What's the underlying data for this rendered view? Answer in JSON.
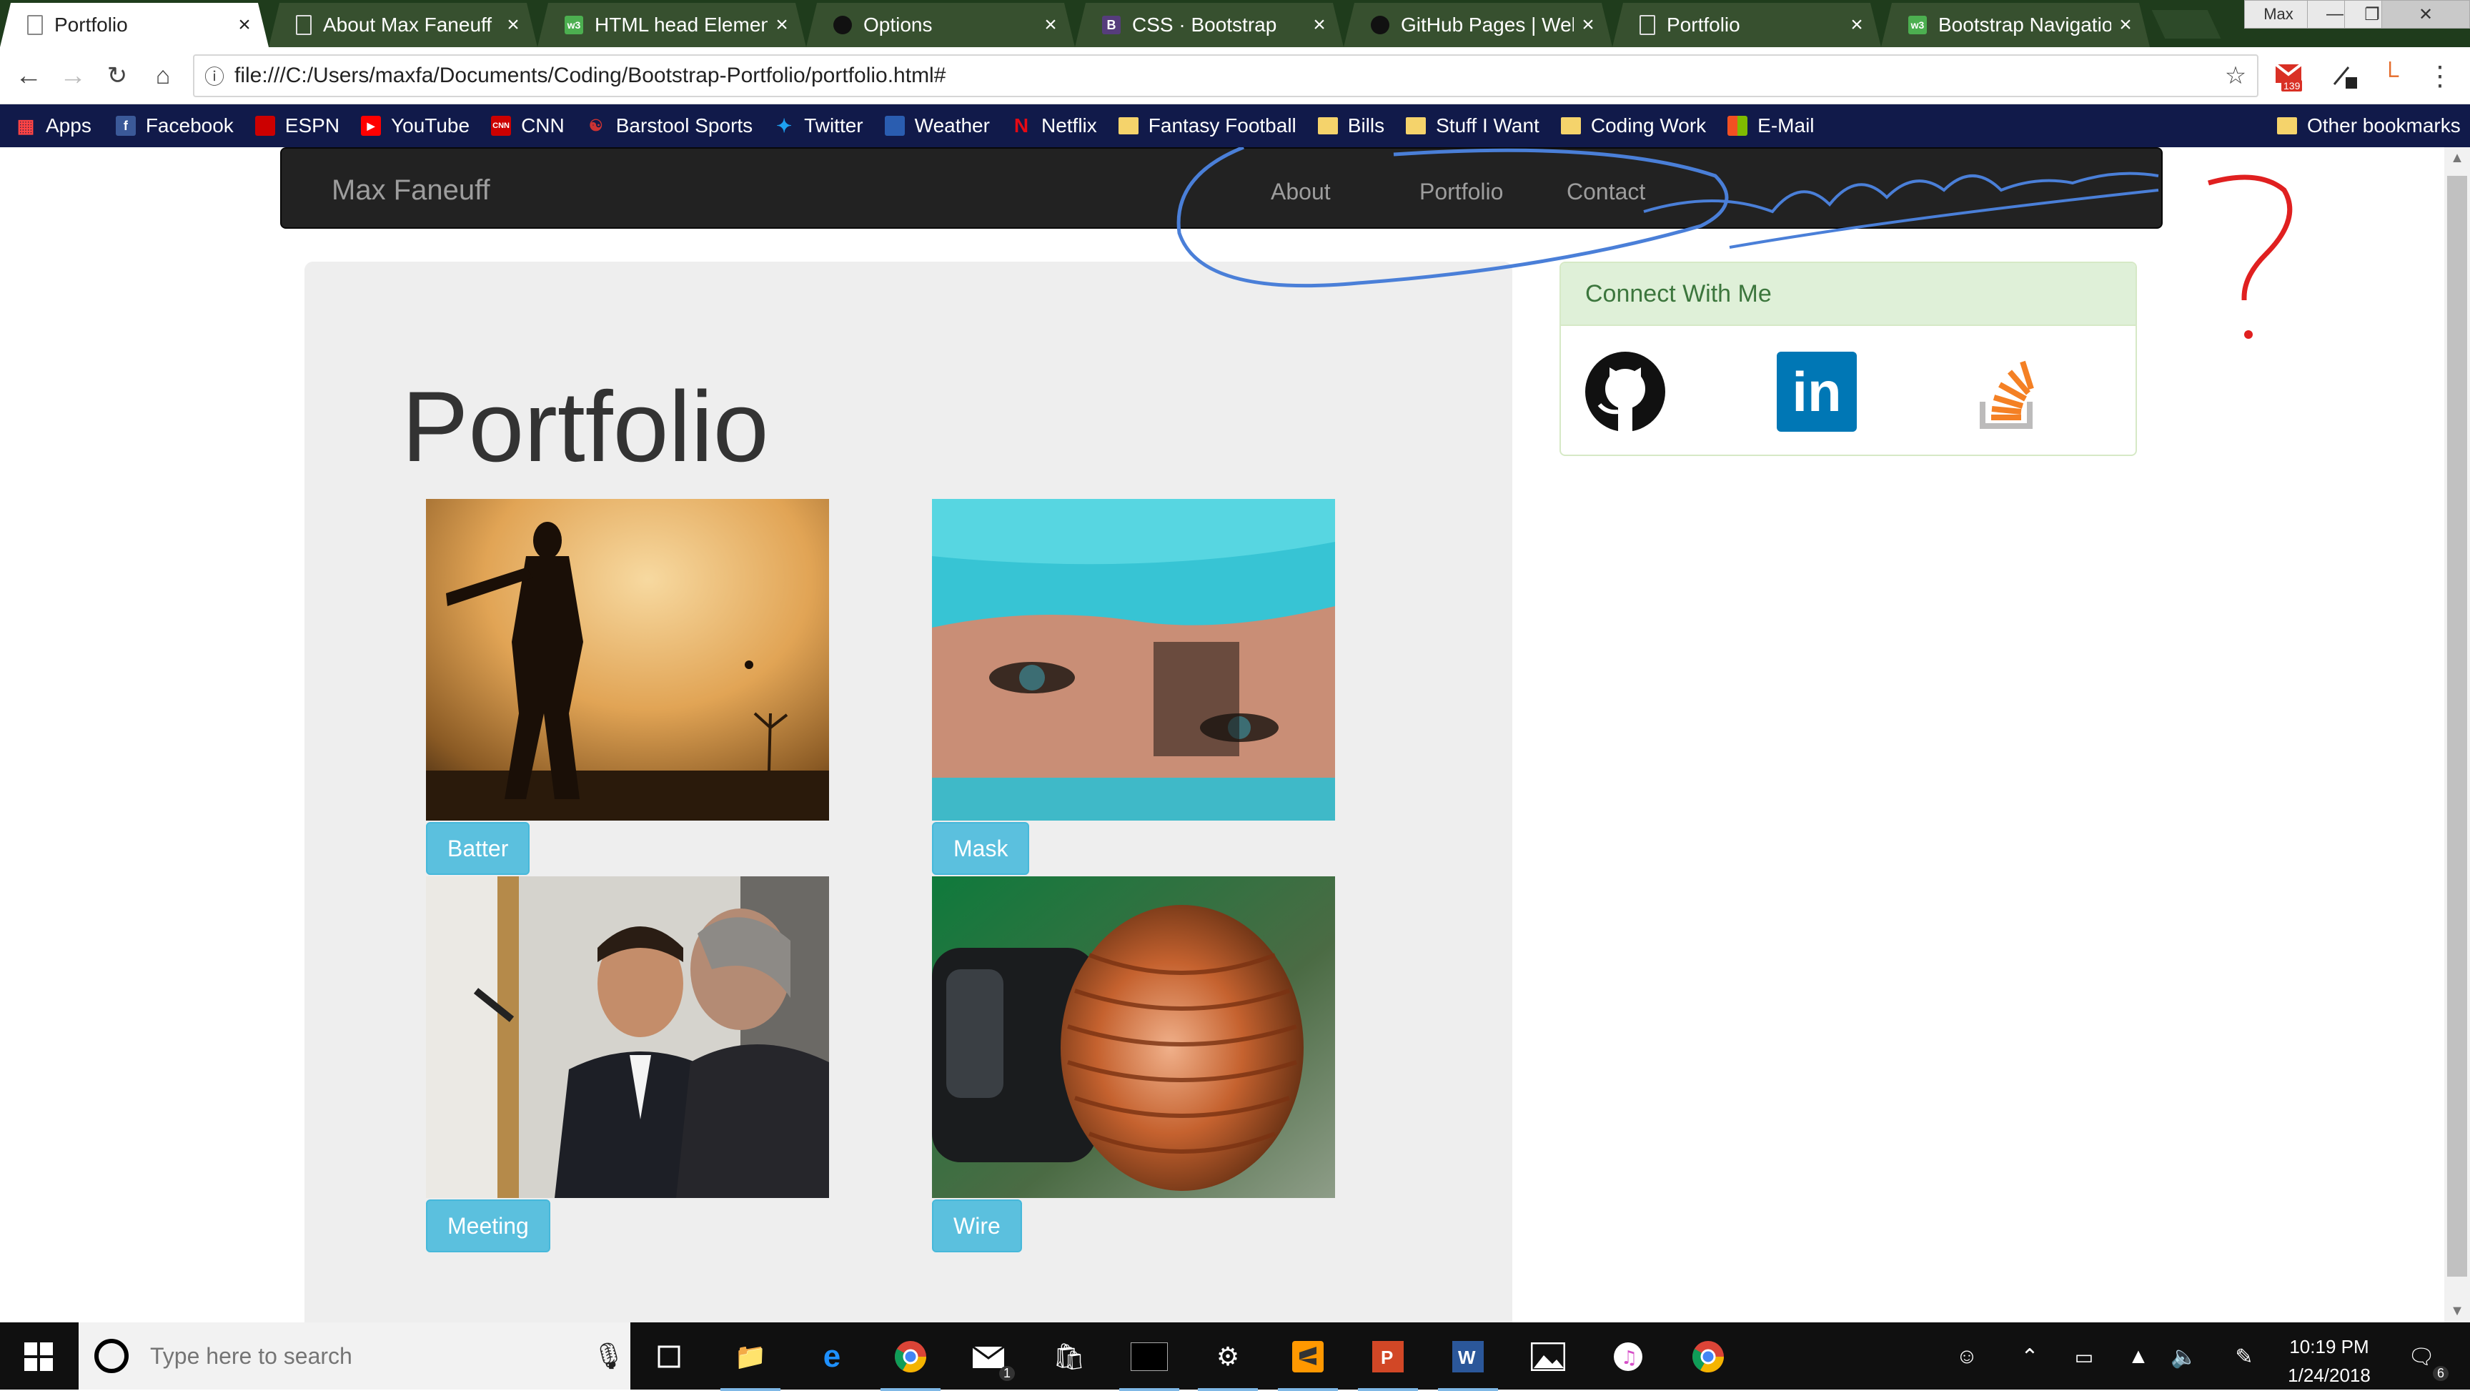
{
  "browser": {
    "tabs": [
      {
        "title": "Portfolio",
        "icon": "page-icon",
        "active": true
      },
      {
        "title": "About Max Faneuff",
        "icon": "page-icon"
      },
      {
        "title": "HTML head Element",
        "icon": "w3schools-icon"
      },
      {
        "title": "Options",
        "icon": "github-icon"
      },
      {
        "title": "CSS · Bootstrap",
        "icon": "bootstrap-icon"
      },
      {
        "title": "GitHub Pages | Websites",
        "icon": "github-icon"
      },
      {
        "title": "Portfolio",
        "icon": "page-icon"
      },
      {
        "title": "Bootstrap Navigation",
        "icon": "w3schools-icon"
      }
    ],
    "profile_label": "Max",
    "close_glyph": "×",
    "url": "file:///C:/Users/maxfa/Documents/Coding/Bootstrap-Portfolio/portfolio.html#",
    "gmail_badge": "139",
    "bookmarks": [
      {
        "label": "Apps",
        "icon": "apps-grid-icon"
      },
      {
        "label": "Facebook",
        "icon": "facebook-icon"
      },
      {
        "label": "ESPN",
        "icon": "espn-icon"
      },
      {
        "label": "YouTube",
        "icon": "youtube-icon"
      },
      {
        "label": "CNN",
        "icon": "cnn-icon"
      },
      {
        "label": "Barstool Sports",
        "icon": "barstool-icon"
      },
      {
        "label": "Twitter",
        "icon": "twitter-icon"
      },
      {
        "label": "Weather",
        "icon": "weather-icon"
      },
      {
        "label": "Netflix",
        "icon": "netflix-icon"
      },
      {
        "label": "Fantasy Football",
        "icon": "folder-icon"
      },
      {
        "label": "Bills",
        "icon": "folder-icon"
      },
      {
        "label": "Stuff I Want",
        "icon": "folder-icon"
      },
      {
        "label": "Coding Work",
        "icon": "folder-icon"
      },
      {
        "label": "E-Mail",
        "icon": "microsoft-icon"
      }
    ],
    "other_bookmarks": "Other bookmarks"
  },
  "site": {
    "brand": "Max Faneuff",
    "nav": [
      "About",
      "Portfolio",
      "Contact"
    ],
    "heading": "Portfolio",
    "items": [
      {
        "label": "Batter"
      },
      {
        "label": "Mask"
      },
      {
        "label": "Meeting"
      },
      {
        "label": "Wire"
      }
    ],
    "connect": {
      "title": "Connect With Me",
      "links": [
        {
          "icon": "github-icon"
        },
        {
          "icon": "linkedin-icon",
          "text": "in"
        },
        {
          "icon": "stackoverflow-icon"
        }
      ]
    }
  },
  "taskbar": {
    "search_placeholder": "Type here to search",
    "time": "10:19 PM",
    "date": "1/24/2018",
    "mail_badge": "1",
    "notification_badge": "6"
  },
  "colors": {
    "tab_strip": "#1f3c1c",
    "bookmarks_bar": "#111a4a",
    "navbar": "#222222",
    "label_button": "#5bc0de",
    "panel_header": "#dff0d8",
    "annotation_blue": "#4a7fd8",
    "annotation_red": "#e02020"
  }
}
